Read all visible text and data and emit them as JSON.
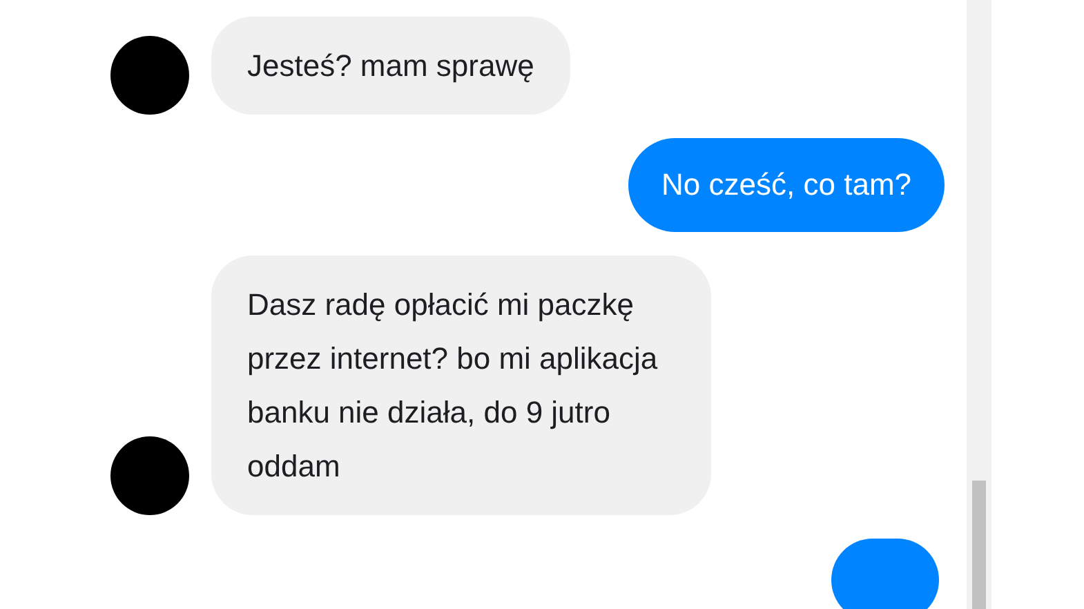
{
  "messages": [
    {
      "kind": "incoming",
      "text": "Jesteś? mam sprawę"
    },
    {
      "kind": "outgoing",
      "text": "No cześć, co tam?"
    },
    {
      "kind": "incoming",
      "text": "Dasz radę opłacić mi paczkę przez internet? bo mi aplikacja banku nie działa, do 9 jutro oddam"
    },
    {
      "kind": "outgoing"
    }
  ]
}
